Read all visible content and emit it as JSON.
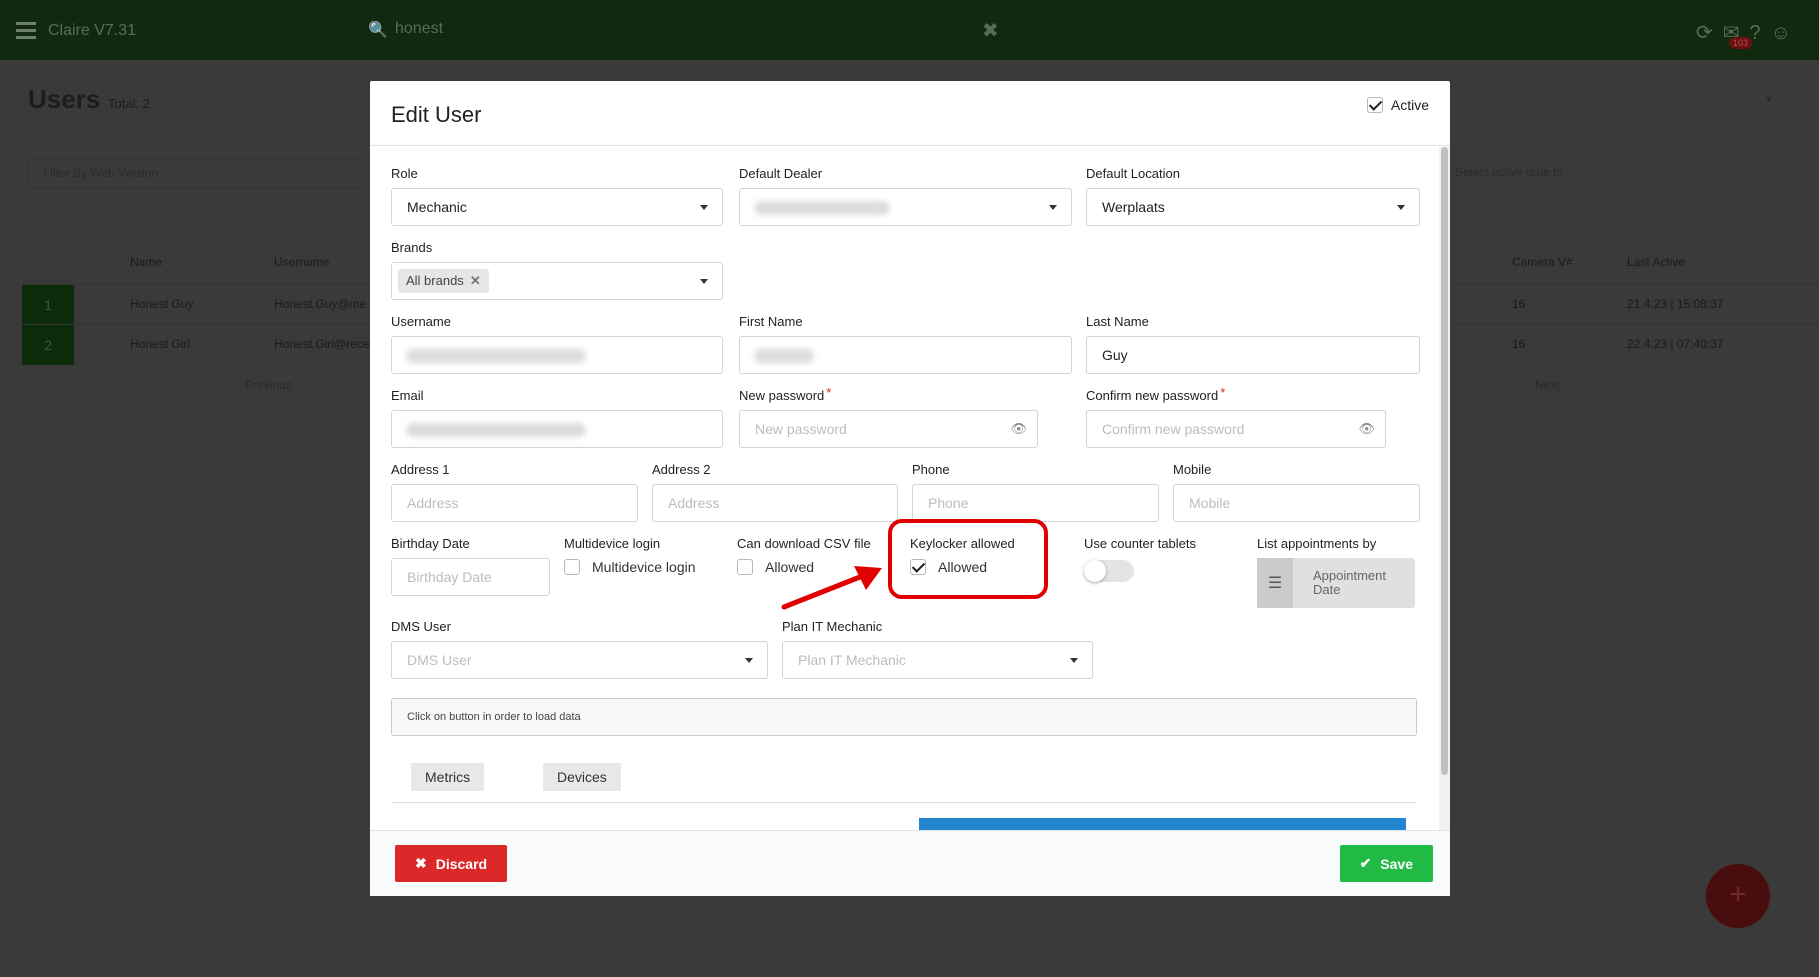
{
  "background": {
    "app_title": "Claire V7.31",
    "search_query": "honest",
    "notification_count": "103",
    "page_title": "Users",
    "total": "Total: 2",
    "filter_placeholder": "Filter By Web Version",
    "date_filter_placeholder": "Select active date to",
    "table": {
      "headers": {
        "name": "Name",
        "username": "Username",
        "camera": "Camera V#",
        "last_active": "Last Active"
      },
      "rows": [
        {
          "num": "1",
          "name": "Honest Guy",
          "username": "Honest.Guy@me",
          "camera": "16",
          "last_active": "21.4.23 | 15:08:37"
        },
        {
          "num": "2",
          "name": "Honest Girl",
          "username": "Honest.Girl@rece",
          "camera": "16",
          "last_active": "22.4.23 | 07:40:37"
        }
      ]
    },
    "previous": "Previous",
    "next": "Next"
  },
  "modal": {
    "title": "Edit User",
    "active_label": "Active",
    "active_checked": true,
    "role": {
      "label": "Role",
      "value": "Mechanic"
    },
    "default_dealer": {
      "label": "Default Dealer"
    },
    "default_location": {
      "label": "Default Location",
      "value": "Werplaats"
    },
    "brands": {
      "label": "Brands",
      "tag": "All brands"
    },
    "username": {
      "label": "Username"
    },
    "first_name": {
      "label": "First Name"
    },
    "last_name": {
      "label": "Last Name",
      "value": "Guy"
    },
    "email": {
      "label": "Email"
    },
    "new_password": {
      "label": "New password",
      "required": "*",
      "placeholder": "New password"
    },
    "confirm_password": {
      "label": "Confirm new password",
      "required": "*",
      "placeholder": "Confirm new password"
    },
    "address1": {
      "label": "Address 1",
      "placeholder": "Address"
    },
    "address2": {
      "label": "Address 2",
      "placeholder": "Address"
    },
    "phone": {
      "label": "Phone",
      "placeholder": "Phone"
    },
    "mobile": {
      "label": "Mobile",
      "placeholder": "Mobile"
    },
    "birthday": {
      "label": "Birthday Date",
      "placeholder": "Birthday Date"
    },
    "multidevice": {
      "label": "Multidevice login",
      "option": "Multidevice login",
      "checked": false
    },
    "csv": {
      "label": "Can download CSV file",
      "option": "Allowed",
      "checked": false
    },
    "keylocker": {
      "label": "Keylocker allowed",
      "option": "Allowed",
      "checked": true
    },
    "counter_tablets": {
      "label": "Use counter tablets",
      "on": false
    },
    "list_appointments": {
      "label": "List appointments by",
      "button_line1": "Appointment",
      "button_line2": "Date"
    },
    "dms_user": {
      "label": "DMS User",
      "placeholder": "DMS User"
    },
    "plan_it": {
      "label": "Plan IT Mechanic",
      "placeholder": "Plan IT Mechanic"
    },
    "info_text": "Click on button in order to load data",
    "tabs": [
      "Metrics",
      "Devices"
    ],
    "discard": "Discard",
    "save": "Save"
  },
  "colors": {
    "discard": "#db2828",
    "save": "#21ba45",
    "annotation": "#e00000",
    "accent_blue": "#2185d0"
  }
}
